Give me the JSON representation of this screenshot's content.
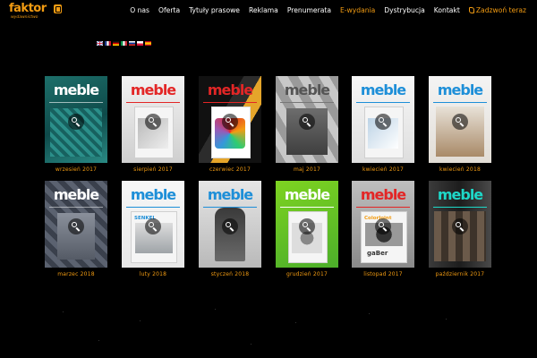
{
  "logo": {
    "word": "faktor",
    "sub": "wydawnictwo"
  },
  "nav": {
    "items": [
      {
        "label": "O nas",
        "active": false
      },
      {
        "label": "Oferta",
        "active": false
      },
      {
        "label": "Tytuły prasowe",
        "active": false
      },
      {
        "label": "Reklama",
        "active": false
      },
      {
        "label": "Prenumerata",
        "active": false
      },
      {
        "label": "E-wydania",
        "active": true
      },
      {
        "label": "Dystrybucja",
        "active": false
      },
      {
        "label": "Kontakt",
        "active": false
      }
    ],
    "phone": "Zadzwoń teraz"
  },
  "colors": {
    "accent": "#f39c12",
    "background": "#000000",
    "brand_red": "#e32626",
    "brand_blue": "#1e8fd8"
  },
  "languages": [
    "en-flag",
    "fr-flag",
    "de-flag",
    "it-flag",
    "ru-flag",
    "pl-flag",
    "es-flag"
  ],
  "magazines": [
    {
      "caption": "wrzesień 2017",
      "brand": "meble",
      "theme": "teal"
    },
    {
      "caption": "sierpień 2017",
      "brand": "meble",
      "theme": "white-red"
    },
    {
      "caption": "czerwiec 2017",
      "brand": "meble",
      "theme": "dark-stripes"
    },
    {
      "caption": "maj 2017",
      "brand": "meble",
      "theme": "grey-hex"
    },
    {
      "caption": "kwiecień 2017",
      "brand": "meble",
      "theme": "white-blue"
    },
    {
      "caption": "kwiecień 2018",
      "brand": "meble",
      "theme": "white-blue-wood"
    },
    {
      "caption": "marzec 2018",
      "brand": "meble",
      "theme": "grey-plaid"
    },
    {
      "caption": "luty 2018",
      "brand": "meble",
      "theme": "white-sofa",
      "inner_text": "SENKEL"
    },
    {
      "caption": "styczeń 2018",
      "brand": "meble",
      "theme": "grey-person"
    },
    {
      "caption": "grudzień 2017",
      "brand": "meble",
      "theme": "green"
    },
    {
      "caption": "listopad 2017",
      "brand": "meble",
      "theme": "grey-orange",
      "inner_text": "ColorJoint",
      "inner_text2": "gaBer"
    },
    {
      "caption": "październik 2017",
      "brand": "meble",
      "theme": "dark-teal"
    }
  ]
}
